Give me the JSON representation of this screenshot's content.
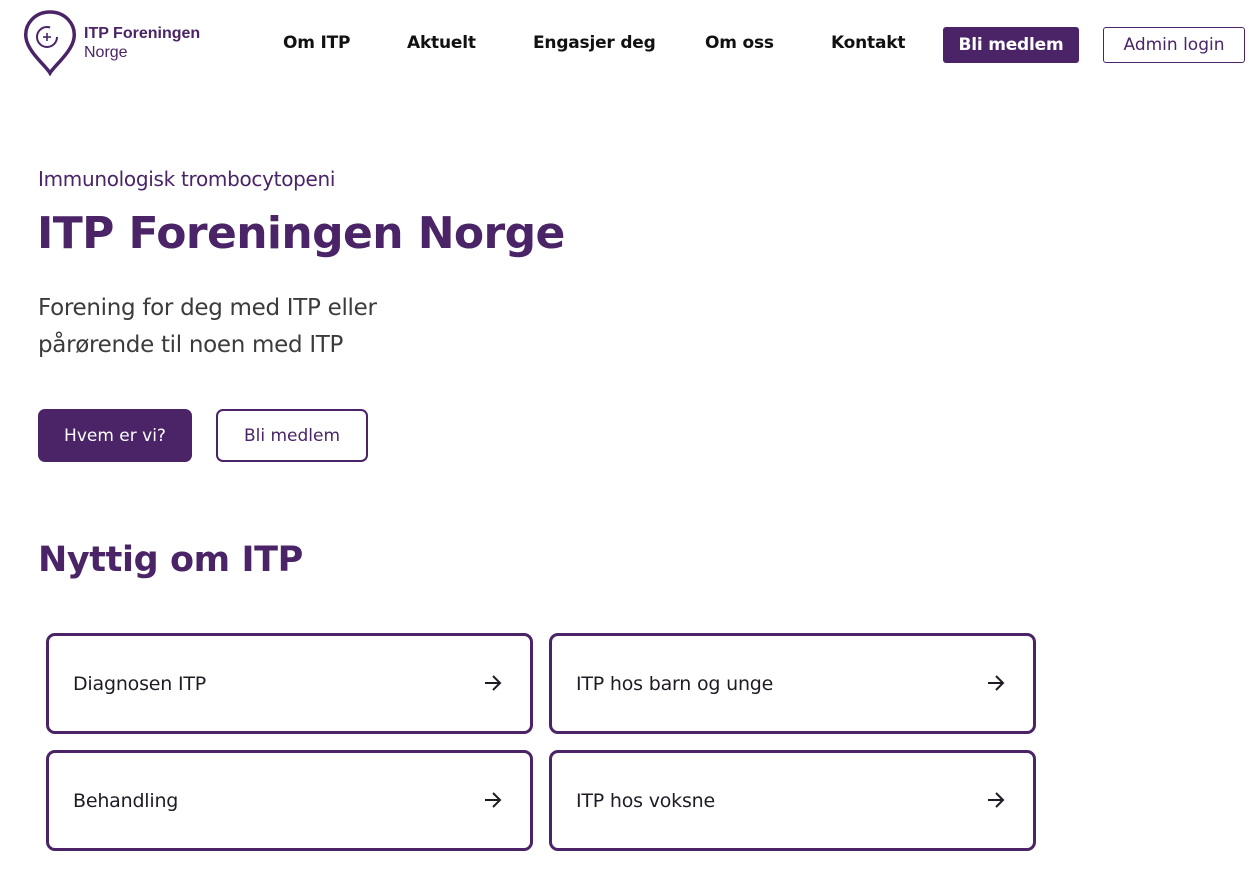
{
  "header": {
    "logo": {
      "line1": "ITP Foreningen",
      "line2": "Norge"
    },
    "nav": [
      "Om ITP",
      "Aktuelt",
      "Engasjer deg",
      "Om oss",
      "Kontakt"
    ],
    "join_label": "Bli medlem",
    "admin_label": "Admin login"
  },
  "hero": {
    "subtitle": "Immunologisk trombocytopeni",
    "title": "ITP Foreningen Norge",
    "description_line1": "Forening for deg med ITP eller",
    "description_line2": "pårørende til noen med ITP",
    "primary_button": "Hvem er vi?",
    "secondary_button": "Bli medlem"
  },
  "useful": {
    "title": "Nyttig om ITP",
    "cards": [
      {
        "label": "Diagnosen ITP",
        "icon": "arrow-right-icon"
      },
      {
        "label": "ITP hos barn og unge",
        "icon": "arrow-right-icon"
      },
      {
        "label": "Behandling",
        "icon": "arrow-right-icon"
      },
      {
        "label": "ITP hos voksne",
        "icon": "arrow-right-icon"
      }
    ]
  },
  "colors": {
    "brand": "#4a2466",
    "text": "#1f1a24",
    "background": "#ffffff"
  }
}
